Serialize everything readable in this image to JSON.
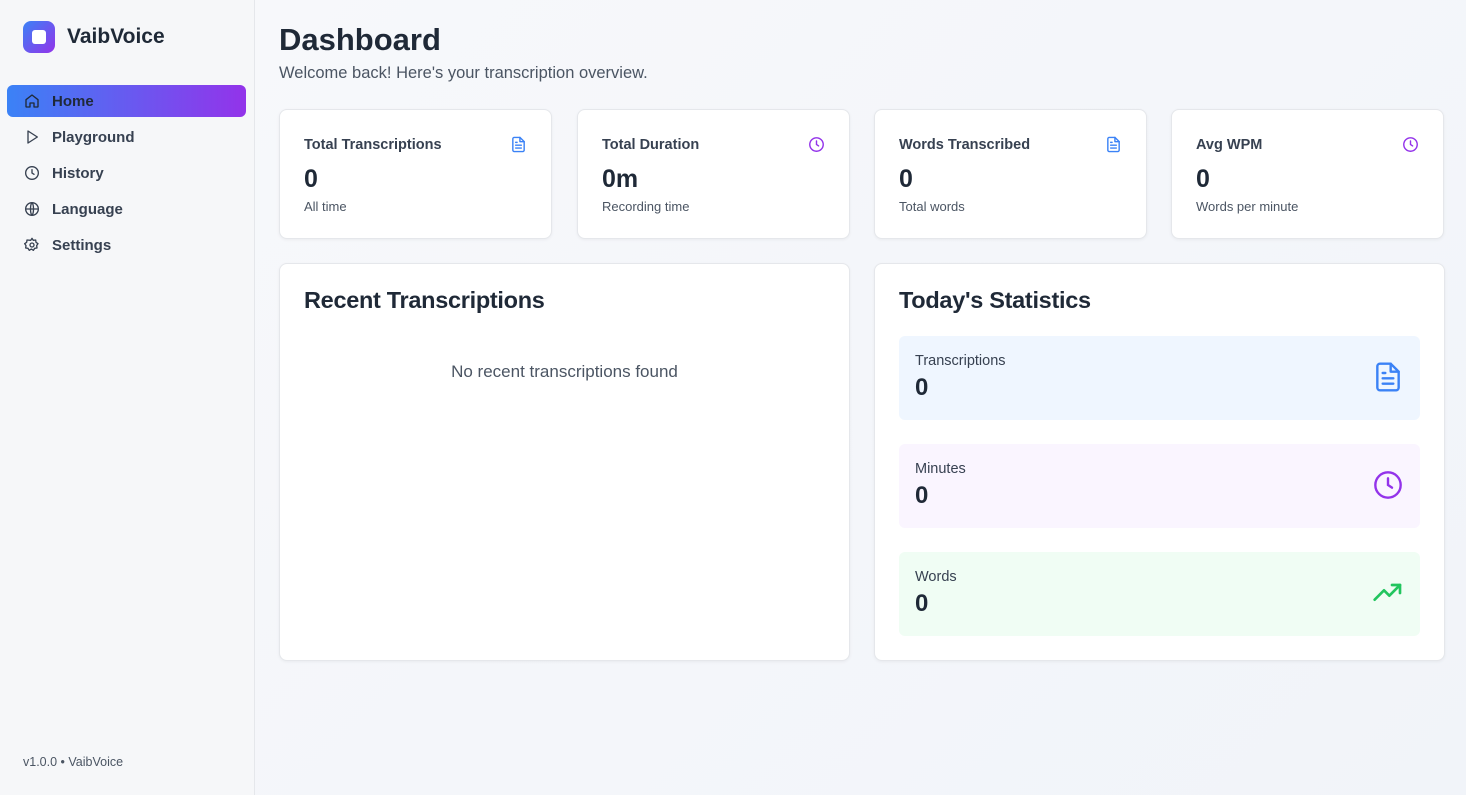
{
  "app": {
    "name": "VaibVoice",
    "version_footer": "v1.0.0 • VaibVoice"
  },
  "sidebar": {
    "items": [
      {
        "label": "Home",
        "icon": "home-icon",
        "active": true
      },
      {
        "label": "Playground",
        "icon": "play-icon",
        "active": false
      },
      {
        "label": "History",
        "icon": "clock-icon",
        "active": false
      },
      {
        "label": "Language",
        "icon": "globe-icon",
        "active": false
      },
      {
        "label": "Settings",
        "icon": "gear-icon",
        "active": false
      }
    ]
  },
  "header": {
    "title": "Dashboard",
    "subtitle": "Welcome back! Here's your transcription overview."
  },
  "stats": [
    {
      "label": "Total Transcriptions",
      "value": "0",
      "sub": "All time",
      "icon": "document-icon",
      "color": "#3b82f6"
    },
    {
      "label": "Total Duration",
      "value": "0m",
      "sub": "Recording time",
      "icon": "clock-icon",
      "color": "#9333ea"
    },
    {
      "label": "Words Transcribed",
      "value": "0",
      "sub": "Total words",
      "icon": "document-icon",
      "color": "#3b82f6"
    },
    {
      "label": "Avg WPM",
      "value": "0",
      "sub": "Words per minute",
      "icon": "clock-icon",
      "color": "#9333ea"
    }
  ],
  "recent": {
    "title": "Recent Transcriptions",
    "empty_message": "No recent transcriptions found"
  },
  "today": {
    "title": "Today's Statistics",
    "items": [
      {
        "label": "Transcriptions",
        "value": "0",
        "icon": "document-icon",
        "color": "#3b82f6",
        "bg": "#eff6ff"
      },
      {
        "label": "Minutes",
        "value": "0",
        "icon": "clock-icon",
        "color": "#9333ea",
        "bg": "#faf5ff"
      },
      {
        "label": "Words",
        "value": "0",
        "icon": "trending-up-icon",
        "color": "#22c55e",
        "bg": "#f0fdf4"
      }
    ]
  }
}
